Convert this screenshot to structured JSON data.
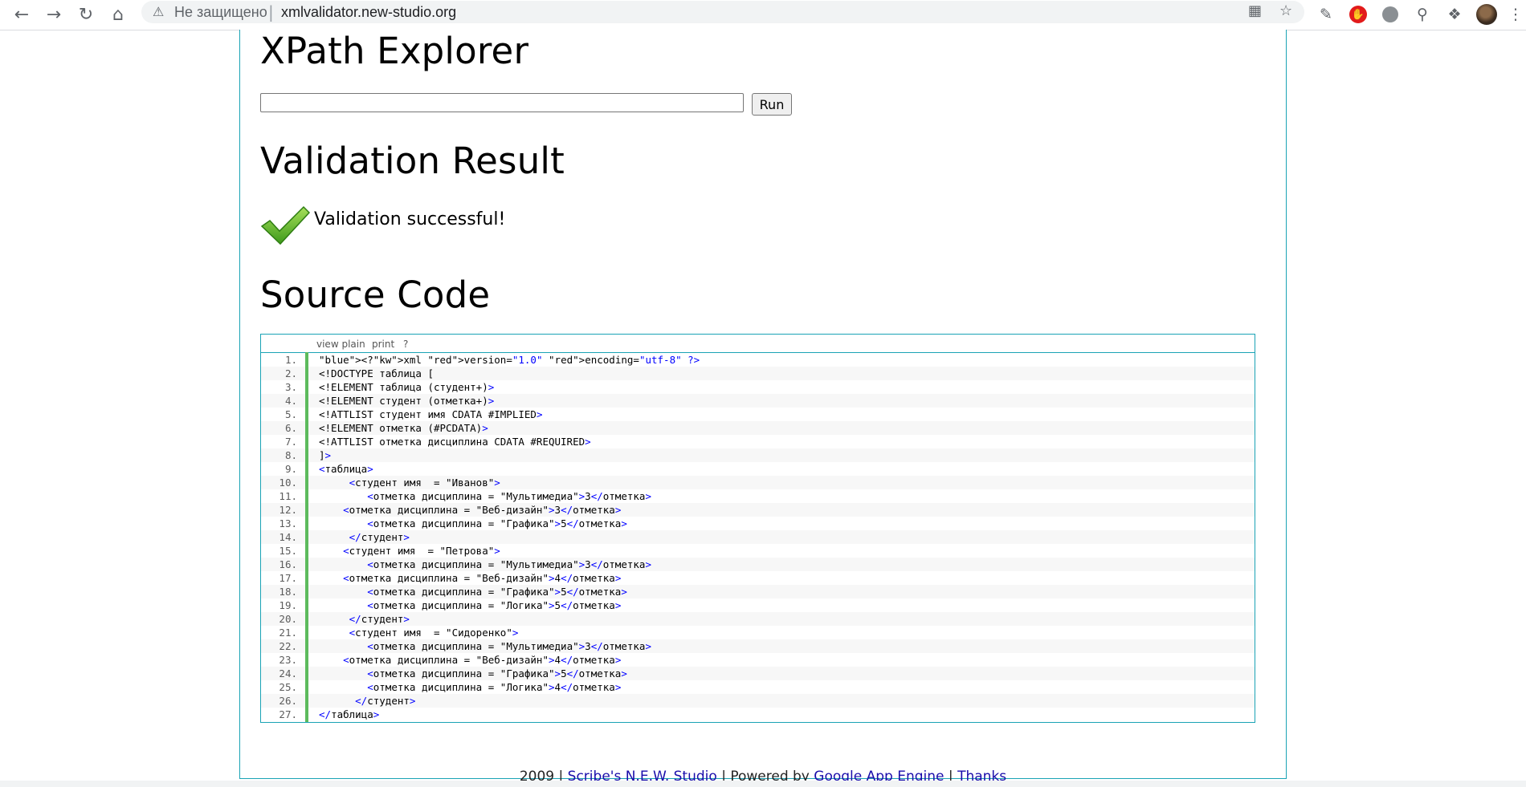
{
  "browser": {
    "security_label": "Не защищено",
    "url": "xmlvalidator.new-studio.org"
  },
  "page": {
    "xpath_title": "XPath Explorer",
    "xpath_input_value": "",
    "run_label": "Run",
    "validation_title": "Validation Result",
    "validation_message": "Validation successful!",
    "source_title": "Source Code",
    "code_toolbar": {
      "view_plain": "view plain",
      "print": "print",
      "help": "?"
    },
    "code_lines": [
      "<?xml version=\"1.0\" encoding=\"utf-8\" ?>",
      "<!DOCTYPE таблица [",
      "<!ELEMENT таблица (студент+)>",
      "<!ELEMENT студент (отметка+)>",
      "<!ATTLIST студент имя CDATA #IMPLIED>",
      "<!ELEMENT отметка (#PCDATA)>",
      "<!ATTLIST отметка дисциплина CDATA #REQUIRED>",
      "]>",
      "<таблица>",
      "     <студент имя  = \"Иванов\">",
      "        <отметка дисциплина = \"Мультимедиа\">3</отметка>",
      "    <отметка дисциплина = \"Веб-дизайн\">3</отметка>",
      "        <отметка дисциплина = \"Графика\">5</отметка>",
      "     </студент>",
      "    <студент имя  = \"Петрова\">",
      "        <отметка дисциплина = \"Мультимедиа\">3</отметка>",
      "    <отметка дисциплина = \"Веб-дизайн\">4</отметка>",
      "        <отметка дисциплина = \"Графика\">5</отметка>",
      "        <отметка дисциплина = \"Логика\">5</отметка>",
      "     </студент>",
      "     <студент имя  = \"Сидоренко\">",
      "        <отметка дисциплина = \"Мультимедиа\">3</отметка>",
      "    <отметка дисциплина = \"Веб-дизайн\">4</отметка>",
      "        <отметка дисциплина = \"Графика\">5</отметка>",
      "        <отметка дисциплина = \"Логика\">4</отметка>",
      "      </студент>",
      "</таблица>"
    ],
    "footer": {
      "year": "2009 |",
      "studio_link": "Scribe's N.E.W. Studio",
      "powered": "| Powered by",
      "gae_link": "Google App Engine",
      "sep": "|",
      "thanks_link": "Thanks"
    }
  }
}
